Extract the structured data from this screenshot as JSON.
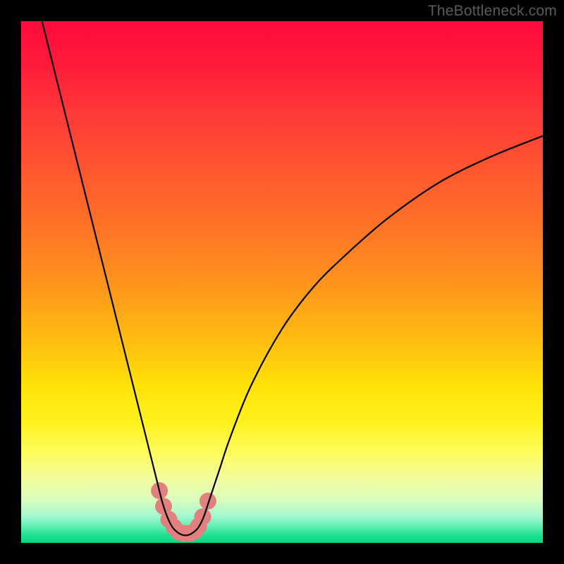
{
  "watermark": "TheBottleneck.com",
  "colors": {
    "frame": "#000000",
    "curve": "#000000",
    "marker_fill": "#e28080",
    "marker_stroke": "#e28080",
    "gradient_top": "#ff0a3c",
    "gradient_bottom": "#06d880"
  },
  "chart_data": {
    "type": "line",
    "title": "",
    "xlabel": "",
    "ylabel": "",
    "xlim": [
      0,
      100
    ],
    "ylim": [
      0,
      100
    ],
    "series": [
      {
        "name": "bottleneck-curve",
        "x": [
          4,
          6,
          8,
          10,
          12,
          14,
          16,
          18,
          20,
          22,
          24,
          26,
          27,
          28,
          29,
          30,
          31,
          32,
          33,
          34,
          35,
          36,
          38,
          40,
          44,
          50,
          56,
          62,
          70,
          80,
          90,
          100
        ],
        "y": [
          100,
          92,
          84,
          76,
          68,
          60,
          52,
          44,
          36,
          28,
          20,
          12,
          8,
          5,
          3,
          2,
          1.5,
          1.5,
          2,
          3,
          5,
          8,
          14,
          20,
          30,
          41,
          49,
          55,
          62,
          69,
          74,
          78
        ]
      }
    ],
    "markers": {
      "name": "highlight-dots",
      "x": [
        26.5,
        27.3,
        28.3,
        29.3,
        30.3,
        31.3,
        32.3,
        33.2,
        34.0,
        34.8,
        35.8
      ],
      "y": [
        10,
        7,
        4.5,
        3,
        2,
        1.8,
        1.8,
        2.2,
        3.2,
        5,
        8
      ],
      "r": 12
    },
    "legend": null,
    "grid": false
  }
}
